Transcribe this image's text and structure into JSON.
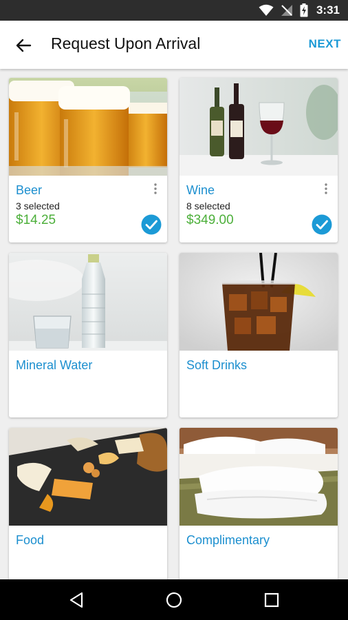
{
  "status_bar": {
    "time": "3:31",
    "icons": [
      "wifi-icon",
      "no-signal-icon",
      "battery-charging-icon"
    ]
  },
  "app_bar": {
    "title": "Request Upon Arrival",
    "next_label": "NEXT",
    "back_icon": "arrow-back-icon"
  },
  "colors": {
    "accent": "#1c9ad6",
    "title_blue": "#1c8fcf",
    "price_green": "#4caf3a",
    "status_bar": "#2d2d2d"
  },
  "categories": [
    {
      "name": "Beer",
      "selected_text": "3 selected",
      "price": "$14.25",
      "checked": true
    },
    {
      "name": "Wine",
      "selected_text": "8 selected",
      "price": "$349.00",
      "checked": true
    },
    {
      "name": "Mineral Water"
    },
    {
      "name": "Soft Drinks"
    },
    {
      "name": "Food"
    },
    {
      "name": "Complimentary"
    }
  ],
  "nav_bar": {
    "icons": [
      "back-triangle-icon",
      "home-circle-icon",
      "recents-square-icon"
    ]
  }
}
